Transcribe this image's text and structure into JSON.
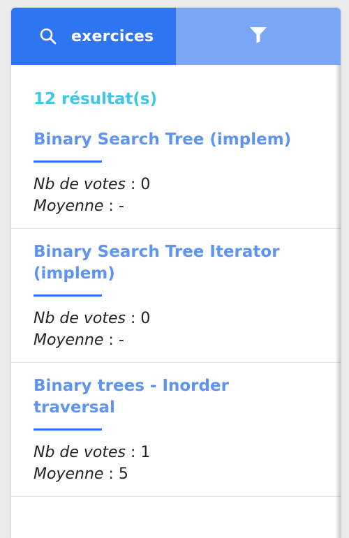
{
  "search": {
    "label": "exercices"
  },
  "results": {
    "count_label": "12 résultat(s)"
  },
  "meta_labels": {
    "votes": "Nb de votes",
    "average": "Moyenne",
    "separator": " : "
  },
  "items": [
    {
      "title": "Binary Search Tree (implem)",
      "votes": "0",
      "average": "-"
    },
    {
      "title": "Binary Search Tree Iterator (implem)",
      "votes": "0",
      "average": "-"
    },
    {
      "title": "Binary trees - Inorder traversal",
      "votes": "1",
      "average": "5"
    }
  ],
  "colors": {
    "search_tab": "#2f74f0",
    "filter_tab": "#7aa6f5",
    "count": "#3cc8ea",
    "title": "#5f95ee"
  },
  "icons": {
    "search": "search-icon",
    "filter": "filter-icon"
  }
}
